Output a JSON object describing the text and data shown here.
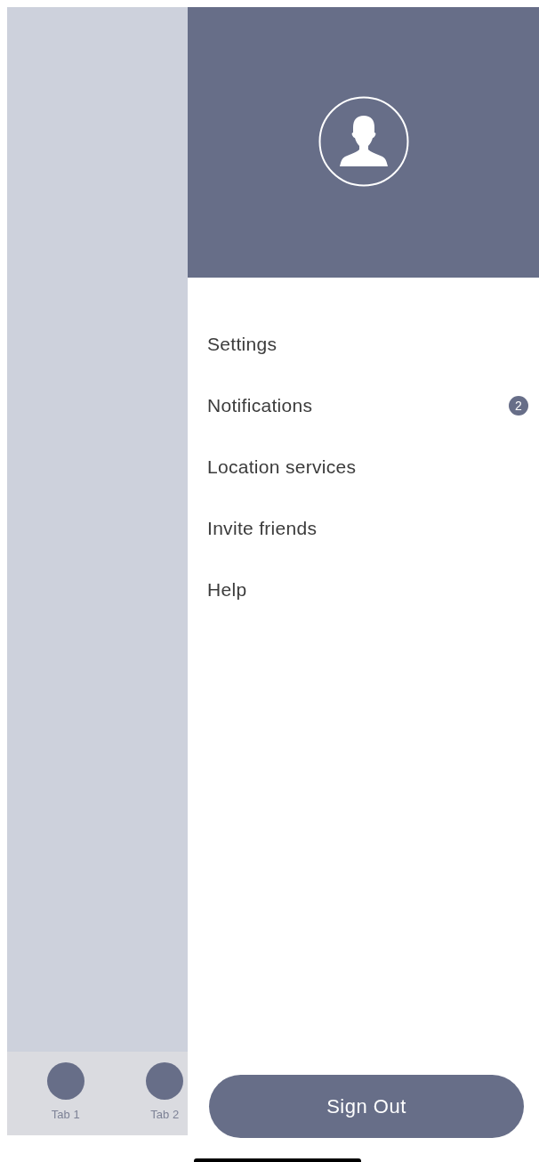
{
  "tab_bar": {
    "tabs": [
      {
        "label": "Tab 1"
      },
      {
        "label": "Tab 2"
      }
    ]
  },
  "drawer": {
    "menu": [
      {
        "label": "Settings"
      },
      {
        "label": "Notifications",
        "badge": "2"
      },
      {
        "label": "Location services"
      },
      {
        "label": "Invite friends"
      },
      {
        "label": "Help"
      }
    ],
    "sign_out": "Sign Out"
  }
}
